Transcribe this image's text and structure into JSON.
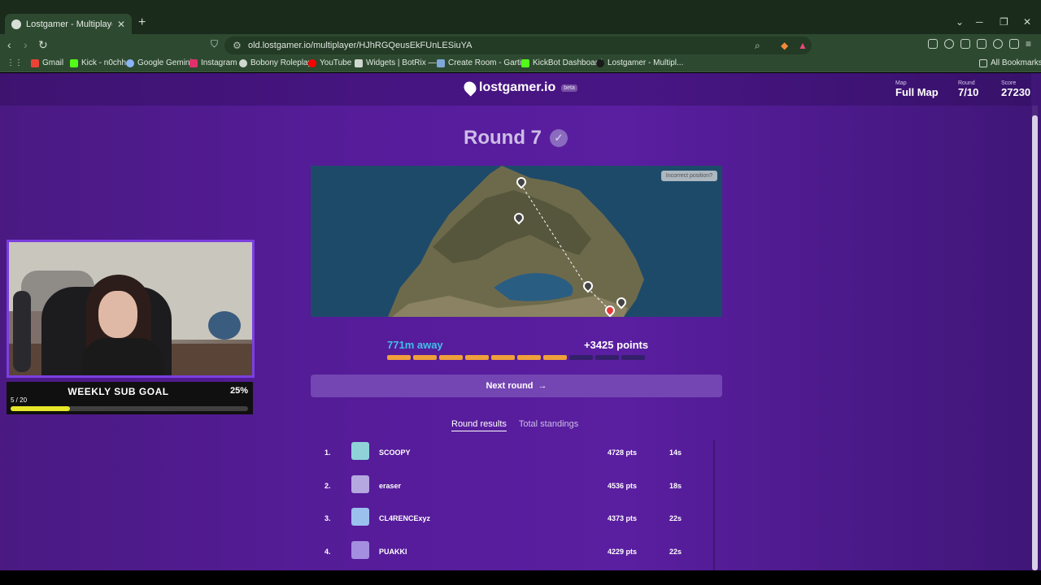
{
  "browser": {
    "tab_title": "Lostgamer - Multiplayer",
    "url": "old.lostgamer.io/multiplayer/HJhRGQeusEkFUnLESiuYA",
    "bookmarks": [
      "Gmail",
      "Kick - n0chh",
      "Google Gemini",
      "Instagram",
      "Bobony Roleplay",
      "YouTube",
      "Widgets | BotRix —...",
      "Create Room - Garti...",
      "KickBot Dashboard",
      "Lostgamer - Multipl..."
    ],
    "all_bookmarks": "All Bookmarks"
  },
  "header": {
    "logo": "lostgamer.io",
    "beta": "beta",
    "map_label": "Map",
    "map_value": "Full Map",
    "round_label": "Round",
    "round_value": "7/10",
    "score_label": "Score",
    "score_value": "27230"
  },
  "round": {
    "title": "Round 7",
    "incorrect_position": "Incorrect position?",
    "distance": "771m away",
    "points": "+3425 points",
    "progress_segments_total": 10,
    "progress_segments_filled": 7,
    "next_button": "Next round"
  },
  "result_tabs": [
    "Round results",
    "Total standings"
  ],
  "results": [
    {
      "rank": "1.",
      "name": "SCOOPY",
      "pts": "4728 pts",
      "time": "14s",
      "color": "#8fd3d8"
    },
    {
      "rank": "2.",
      "name": "eraser",
      "pts": "4536 pts",
      "time": "18s",
      "color": "#b5a8e0"
    },
    {
      "rank": "3.",
      "name": "CL4RENCExyz",
      "pts": "4373 pts",
      "time": "22s",
      "color": "#9cc0ee"
    },
    {
      "rank": "4.",
      "name": "PUAKKI",
      "pts": "4229 pts",
      "time": "22s",
      "color": "#a48ee0"
    }
  ],
  "sub_goal": {
    "title": "WEEKLY SUB GOAL",
    "percent": "25%",
    "count": "5 / 20",
    "fraction": 0.25
  }
}
